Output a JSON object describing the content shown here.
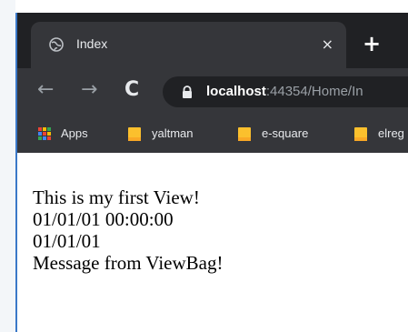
{
  "tab": {
    "title": "Index",
    "close_glyph": "×",
    "favicon_icon": "globe-icon"
  },
  "new_tab_glyph": "+",
  "toolbar": {
    "back_glyph": "←",
    "forward_glyph": "→",
    "reload_glyph": "C",
    "url_host": "localhost",
    "url_rest": ":44354/Home/In"
  },
  "bookmarks": [
    {
      "label": "Apps",
      "icon": "apps-grid-icon"
    },
    {
      "label": "yaltman",
      "icon": "folder-icon"
    },
    {
      "label": "e-square",
      "icon": "folder-icon"
    },
    {
      "label": "elreg",
      "icon": "folder-icon"
    }
  ],
  "page": {
    "lines": [
      "This is my first View!",
      "01/01/01 00:00:00",
      "01/01/01",
      "Message from ViewBag!"
    ]
  },
  "colors": {
    "titlebar": "#202124",
    "tab": "#35363a",
    "folder": "#fbc02d",
    "accent_edge": "#3a78c8"
  }
}
